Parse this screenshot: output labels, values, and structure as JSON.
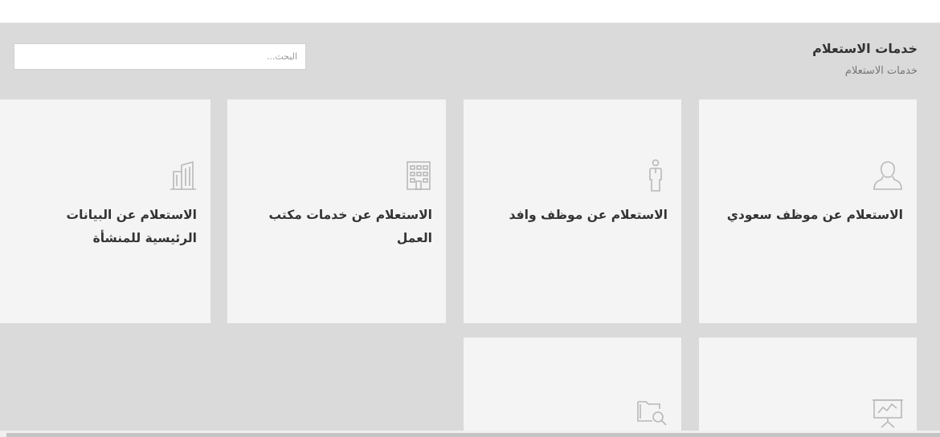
{
  "header": {
    "title": "خدمات الاستعلام",
    "breadcrumb": "خدمات الاستعلام"
  },
  "search": {
    "placeholder": "البحث...",
    "value": ""
  },
  "cards": [
    {
      "label": "الاستعلام عن موظف سعودي",
      "icon": "user-icon"
    },
    {
      "label": "الاستعلام عن موظف وافد",
      "icon": "standing-person-icon"
    },
    {
      "label": "الاستعلام عن خدمات مكتب العمل",
      "icon": "office-building-icon"
    },
    {
      "label": "الاستعلام عن البيانات الرئيسية للمنشأة",
      "icon": "buildings-icon"
    },
    {
      "label": "",
      "icon": "presentation-board-icon"
    },
    {
      "label": "",
      "icon": "folder-search-icon"
    }
  ],
  "colors": {
    "background": "#dadada",
    "card": "#f4f4f4",
    "text": "#333333",
    "icon": "#b8b8b8"
  }
}
